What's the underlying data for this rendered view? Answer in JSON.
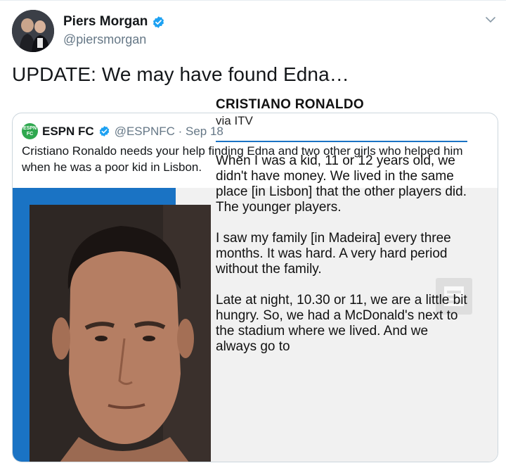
{
  "author": {
    "name": "Piers Morgan",
    "handle": "@piersmorgan",
    "avatar_icon": "avatar-photo",
    "verified_icon": "verified-badge-icon"
  },
  "tweet": {
    "text": "UPDATE: We may have found Edna…"
  },
  "menu": {
    "icon": "chevron-down-icon"
  },
  "quoted": {
    "logo_text": "ESPN FC",
    "name": "ESPN FC",
    "handle_date": "@ESPNFC · Sep 18",
    "text": "Cristiano Ronaldo needs your help finding Edna and two other girls who helped him when he was a poor kid in Lisbon.",
    "card": {
      "title": "CRISTIANO RONALDO",
      "subtitle": "via ITV",
      "paragraphs": [
        "When I was a kid, 11 or 12 years old, we didn't have money. We lived in the same place [in Lisbon] that the other players did. The younger players.",
        "I saw my family [in Madeira] every three months. It was hard. A very hard period without the family.",
        "Late at night, 10.30 or 11, we are a little bit hungry. So, we had a McDonald's next to the stadium where we lived. And we always go to"
      ]
    }
  },
  "colors": {
    "accent": "#1da1f2",
    "espn_green": "#2fa84f",
    "card_blue": "#1a73c4",
    "muted": "#657786"
  }
}
